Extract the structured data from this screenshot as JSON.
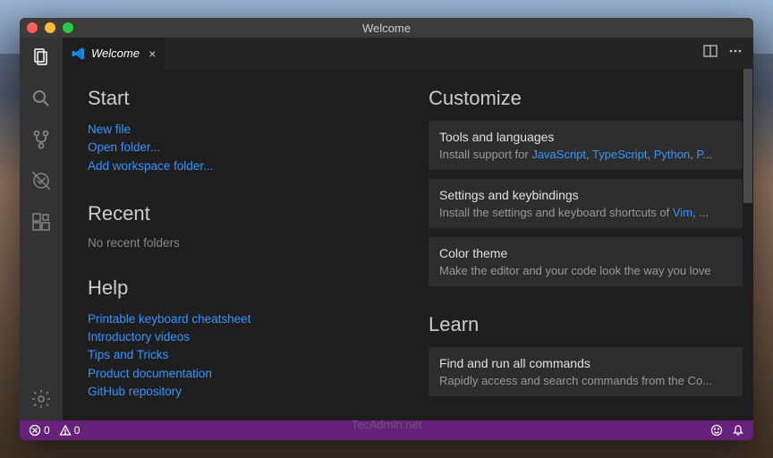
{
  "window": {
    "title": "Welcome"
  },
  "tab": {
    "label": "Welcome"
  },
  "start": {
    "heading": "Start",
    "new_file": "New file",
    "open_folder": "Open folder...",
    "add_workspace": "Add workspace folder..."
  },
  "recent": {
    "heading": "Recent",
    "empty": "No recent folders"
  },
  "help": {
    "heading": "Help",
    "cheatsheet": "Printable keyboard cheatsheet",
    "videos": "Introductory videos",
    "tips": "Tips and Tricks",
    "docs": "Product documentation",
    "github": "GitHub repository"
  },
  "customize": {
    "heading": "Customize",
    "tools": {
      "title": "Tools and languages",
      "prefix": "Install support for ",
      "langs": [
        "JavaScript",
        "TypeScript",
        "Python",
        "P"
      ],
      "sep": ", "
    },
    "settings": {
      "title": "Settings and keybindings",
      "prefix": "Install the settings and keyboard shortcuts of ",
      "langs": [
        "Vim"
      ],
      "suffix": ", ..."
    },
    "theme": {
      "title": "Color theme",
      "desc": "Make the editor and your code look the way you love"
    }
  },
  "learn": {
    "heading": "Learn",
    "commands": {
      "title": "Find and run all commands",
      "desc": "Rapidly access and search commands from the Co..."
    }
  },
  "status": {
    "errors": "0",
    "warnings": "0"
  },
  "watermark": "TecAdmin.net"
}
